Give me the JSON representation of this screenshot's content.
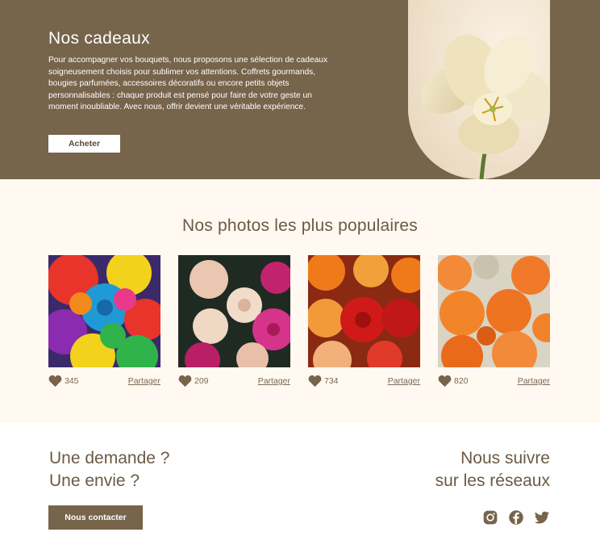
{
  "hero": {
    "title": "Nos cadeaux",
    "text": "Pour accompagner vos bouquets, nous proposons une sélection de cadeaux soigneusement choisis pour sublimer vos attentions. Coffrets gourmands, bougies parfumées, accessoires décoratifs ou encore petits objets personnalisables : chaque produit est pensé pour faire de votre geste un moment inoubliable. Avec nous, offrir devient une véritable expérience.",
    "button_label": "Acheter",
    "image_icon": "white-tulip-photo"
  },
  "gallery": {
    "title": "Nos photos les plus populaires",
    "items": [
      {
        "likes": "345",
        "share_label": "Partager",
        "photo": "rainbow-roses-photo"
      },
      {
        "likes": "209",
        "share_label": "Partager",
        "photo": "peony-bouquet-photo"
      },
      {
        "likes": "734",
        "share_label": "Partager",
        "photo": "red-orange-roses-photo"
      },
      {
        "likes": "820",
        "share_label": "Partager",
        "photo": "orange-roses-photo"
      }
    ]
  },
  "footer": {
    "contact_line1": "Une demande ?",
    "contact_line2": "Une envie ?",
    "contact_button": "Nous contacter",
    "social_line1": "Nous suivre",
    "social_line2": "sur les réseaux",
    "social_icons": [
      "instagram-icon",
      "facebook-icon",
      "twitter-icon"
    ]
  },
  "colors": {
    "brown": "#76644b",
    "cream": "#fff9f1",
    "text": "#6b5a44"
  }
}
